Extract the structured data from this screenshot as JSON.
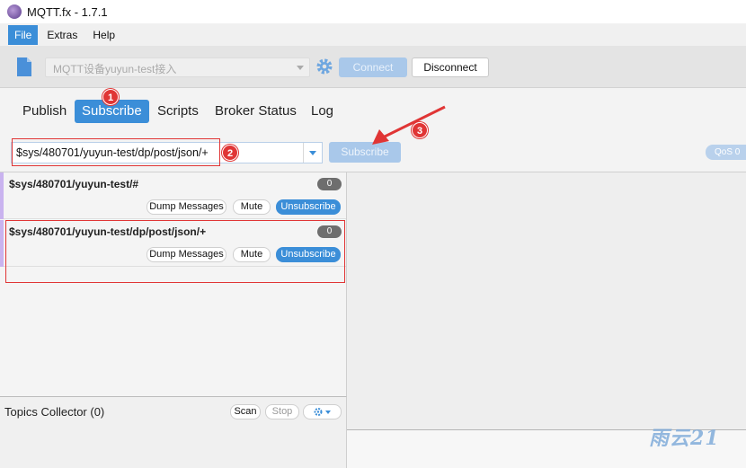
{
  "window": {
    "title": "MQTT.fx - 1.7.1"
  },
  "menu": {
    "items": [
      "File",
      "Extras",
      "Help"
    ]
  },
  "toolbar": {
    "profile_value": "MQTT设备yuyun-test接入",
    "connect_label": "Connect",
    "disconnect_label": "Disconnect"
  },
  "tabs": [
    "Publish",
    "Subscribe",
    "Scripts",
    "Broker Status",
    "Log"
  ],
  "subscribe_row": {
    "topic_value": "$sys/480701/yuyun-test/dp/post/json/+",
    "subscribe_label": "Subscribe",
    "qos_label": "QoS 0"
  },
  "subscriptions": [
    {
      "topic": "$sys/480701/yuyun-test/#",
      "count": "0",
      "dump_label": "Dump Messages",
      "mute_label": "Mute",
      "unsubscribe_label": "Unsubscribe"
    },
    {
      "topic": "$sys/480701/yuyun-test/dp/post/json/+",
      "count": "0",
      "dump_label": "Dump Messages",
      "mute_label": "Mute",
      "unsubscribe_label": "Unsubscribe"
    }
  ],
  "collector": {
    "label": "Topics Collector (0)",
    "scan_label": "Scan",
    "stop_label": "Stop"
  },
  "annotations": {
    "badge1": "1",
    "badge2": "2",
    "badge3": "3"
  },
  "watermark": "雨云21",
  "colors": {
    "accent": "#3b8ed8",
    "annotation_red": "#e03535",
    "accent_disabled": "#a9c8ea"
  },
  "icons": {
    "app": "mqttfx-logo-icon",
    "profile": "document-icon",
    "settings": "gear-icon",
    "dropdown": "chevron-down-icon"
  }
}
